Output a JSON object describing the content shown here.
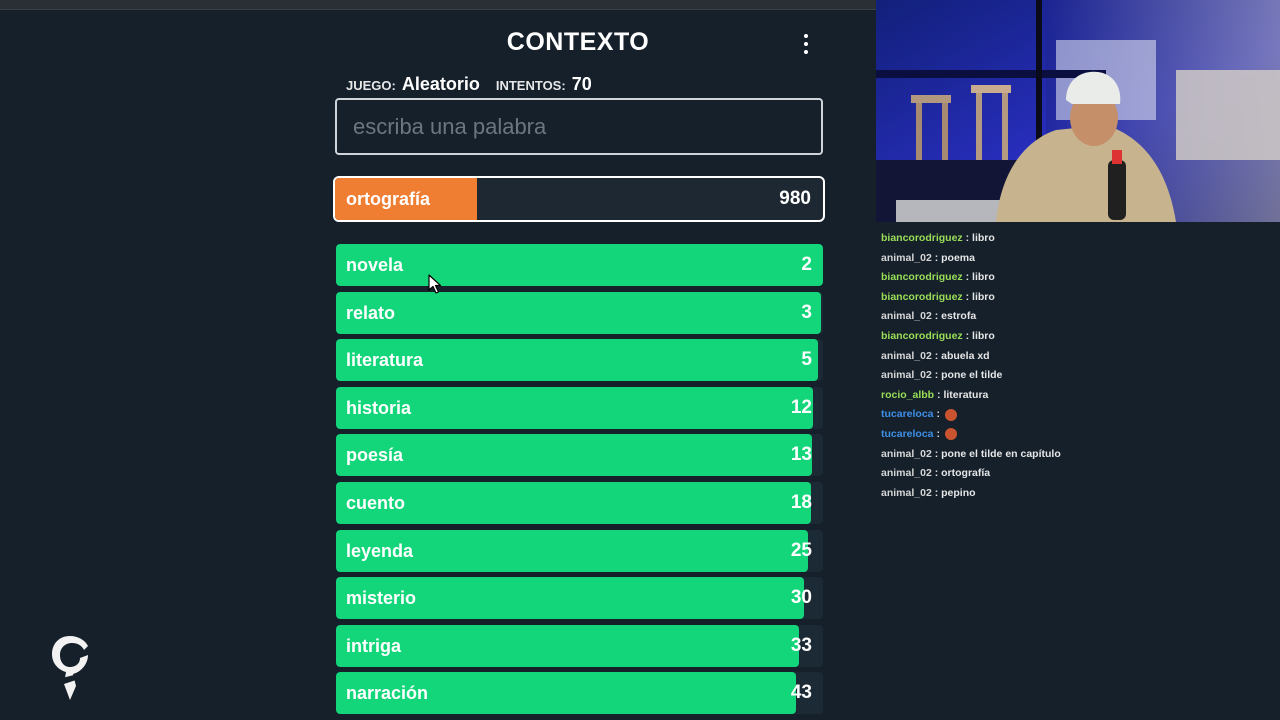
{
  "game": {
    "title": "CONTEXTO",
    "juego_label": "JUEGO:",
    "juego_value": "Aleatorio",
    "intentos_label": "INTENTOS:",
    "intentos_value": "70",
    "input_placeholder": "escriba una palabra",
    "current_guess": {
      "word": "ortografía",
      "rank": "980",
      "fill": 0.29,
      "color": "#ef7d32"
    },
    "guess_color": "#13d67a",
    "guesses": [
      {
        "word": "novela",
        "rank": "2",
        "fill": 1.0
      },
      {
        "word": "relato",
        "rank": "3",
        "fill": 0.995
      },
      {
        "word": "literatura",
        "rank": "5",
        "fill": 0.99
      },
      {
        "word": "historia",
        "rank": "12",
        "fill": 0.98
      },
      {
        "word": "poesía",
        "rank": "13",
        "fill": 0.978
      },
      {
        "word": "cuento",
        "rank": "18",
        "fill": 0.975
      },
      {
        "word": "leyenda",
        "rank": "25",
        "fill": 0.97
      },
      {
        "word": "misterio",
        "rank": "30",
        "fill": 0.96
      },
      {
        "word": "intriga",
        "rank": "33",
        "fill": 0.95
      },
      {
        "word": "narración",
        "rank": "43",
        "fill": 0.945
      }
    ]
  },
  "chat": {
    "messages": [
      {
        "user": "biancorodriguez",
        "color": "#9ade57",
        "text": "libro"
      },
      {
        "user": "animal_02",
        "color": "#d6d6d6",
        "text": "poema"
      },
      {
        "user": "biancorodriguez",
        "color": "#9ade57",
        "text": "libro"
      },
      {
        "user": "biancorodriguez",
        "color": "#9ade57",
        "text": "libro"
      },
      {
        "user": "animal_02",
        "color": "#d6d6d6",
        "text": "estrofa"
      },
      {
        "user": "biancorodriguez",
        "color": "#9ade57",
        "text": "libro"
      },
      {
        "user": "animal_02",
        "color": "#d6d6d6",
        "text": "abuela xd"
      },
      {
        "user": "animal_02",
        "color": "#d6d6d6",
        "text": "pone el tilde"
      },
      {
        "user": "rocio_albb",
        "color": "#9ade57",
        "text": "literatura"
      },
      {
        "user": "tucareloca",
        "color": "#3e8fe6",
        "text": "",
        "emote": "emote-icon"
      },
      {
        "user": "tucareloca",
        "color": "#3e8fe6",
        "text": "",
        "emote": "emote-icon"
      },
      {
        "user": "animal_02",
        "color": "#d6d6d6",
        "text": "pone el tilde en capítulo"
      },
      {
        "user": "animal_02",
        "color": "#d6d6d6",
        "text": "ortografía"
      },
      {
        "user": "animal_02",
        "color": "#d6d6d6",
        "text": "pepino"
      }
    ]
  }
}
